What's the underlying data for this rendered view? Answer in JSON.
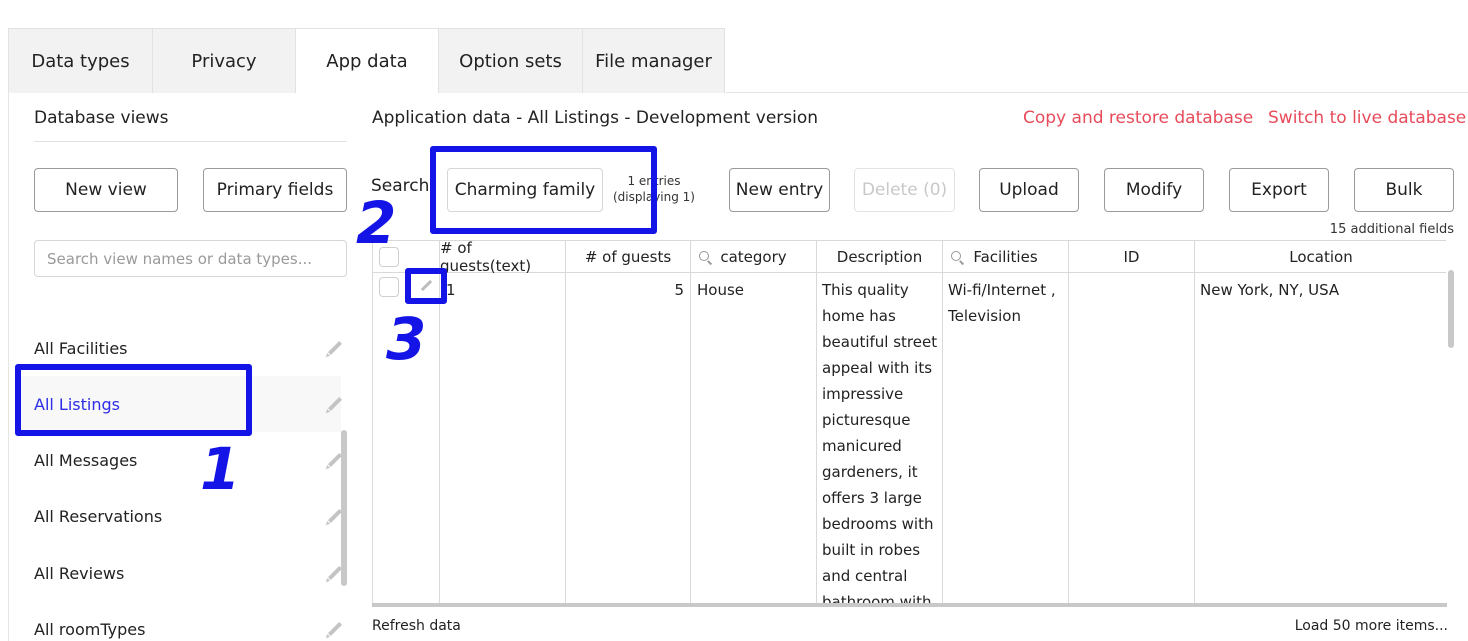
{
  "tabs": [
    "Data types",
    "Privacy",
    "App data",
    "Option sets",
    "File manager"
  ],
  "active_tab": "App data",
  "sidebar": {
    "title": "Database views",
    "new_view_label": "New view",
    "primary_fields_label": "Primary fields",
    "search_placeholder": "Search view names or data types...",
    "items": [
      {
        "label": "All Facilities"
      },
      {
        "label": "All Listings",
        "selected": true
      },
      {
        "label": "All Messages"
      },
      {
        "label": "All Reservations"
      },
      {
        "label": "All Reviews"
      },
      {
        "label": "All roomTypes"
      }
    ]
  },
  "main": {
    "title": "Application data - All Listings - Development version",
    "copy_restore_label": "Copy and restore database",
    "switch_live_label": "Switch to live database",
    "search_label": "Search",
    "search_value": "Charming family",
    "entries_line1": "1 entries",
    "entries_line2": "(displaying 1)",
    "buttons": {
      "new_entry": "New entry",
      "delete": "Delete (0)",
      "upload": "Upload",
      "modify": "Modify",
      "export": "Export",
      "bulk": "Bulk"
    },
    "additional_fields": "15 additional fields",
    "table": {
      "columns": [
        "",
        "# of guests(text)",
        "# of guests",
        "category",
        "Description",
        "Facilities",
        "ID",
        "Location"
      ],
      "rows": [
        {
          "guests_text": "1",
          "guests": "5",
          "category": "House",
          "description": "This quality home has beautiful street appeal with its impressive picturesque manicured gardeners, it offers 3 large bedrooms with built in robes and central bathroom with",
          "facilities": "Wi-fi/Internet , Television",
          "id": "",
          "location": "New York, NY, USA"
        }
      ]
    },
    "refresh_label": "Refresh data",
    "load_more_label": "Load 50 more items..."
  },
  "annotations": [
    "1",
    "2",
    "3"
  ],
  "colors": {
    "accent_red": "#e84b5a",
    "selected_blue": "#2d2de8",
    "annotation_blue": "#1414e6"
  }
}
